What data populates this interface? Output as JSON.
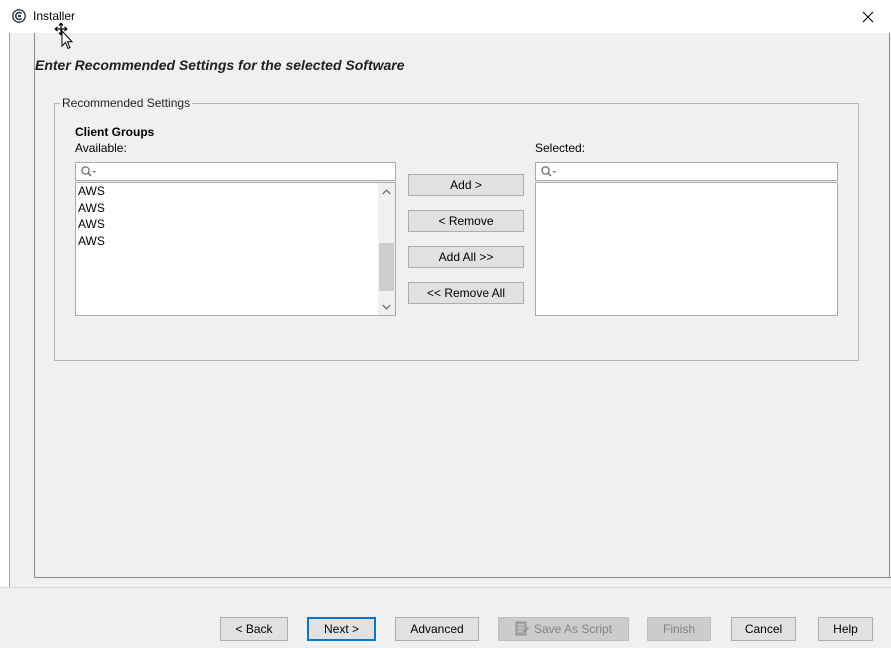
{
  "window": {
    "title": "Installer",
    "app_icon": "installer-logo-icon",
    "close_icon": "close-icon"
  },
  "page": {
    "heading": "Enter Recommended Settings for the selected Software"
  },
  "group": {
    "legend": "Recommended Settings",
    "sub_heading": "Client Groups",
    "available_label": "Available:",
    "selected_label": "Selected:",
    "available_items": [
      "AWS",
      "AWS",
      "AWS",
      "AWS"
    ],
    "selected_items": []
  },
  "transfer_buttons": {
    "add": "Add >",
    "remove": "< Remove",
    "add_all": "Add All >>",
    "remove_all": "<< Remove All"
  },
  "footer": {
    "back": "< Back",
    "next": "Next >",
    "advanced": "Advanced",
    "save_as_script": "Save As Script",
    "finish": "Finish",
    "cancel": "Cancel",
    "help": "Help"
  },
  "colors": {
    "panel_bg": "#f0f0f0",
    "default_button_border": "#0078d7",
    "disabled_text": "#838383"
  }
}
